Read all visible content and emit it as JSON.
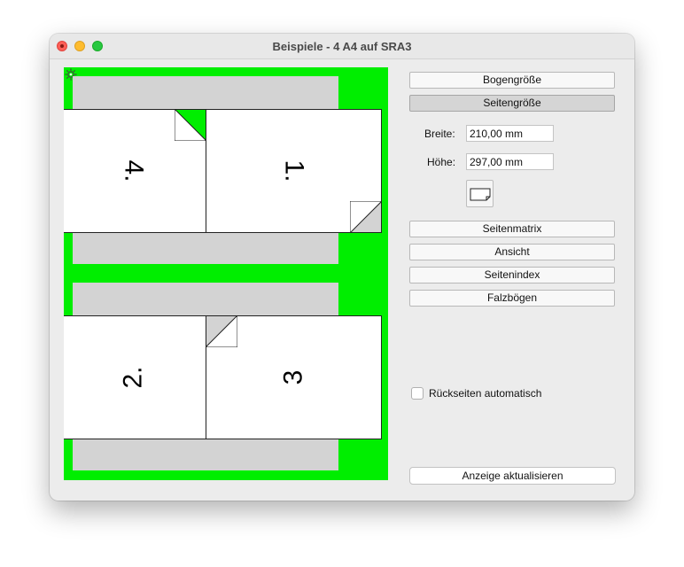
{
  "window": {
    "title": "Beispiele - 4 A4 auf SRA3"
  },
  "preview": {
    "pages": [
      "4.",
      "1.",
      "2.",
      "3"
    ]
  },
  "panel": {
    "buttons": [
      "Bogengröße",
      "Seitengröße",
      "Seitenmatrix",
      "Ansicht",
      "Seitenindex",
      "Falzbögen"
    ],
    "active": "Seitengröße",
    "width_label": "Breite:",
    "width_value": "210,00 mm",
    "height_label": "Höhe:",
    "height_value": "297,00 mm",
    "auto_backsides_label": "Rückseiten automatisch",
    "auto_backsides_checked": false,
    "update_button": "Anzeige aktualisieren"
  },
  "colors": {
    "preview_bg": "#00ee00",
    "sheet": "#d3d3d3",
    "page": "#ffffff"
  },
  "icons": [
    "gear-icon",
    "page-orientation-icon",
    "fold-corner-icon"
  ]
}
